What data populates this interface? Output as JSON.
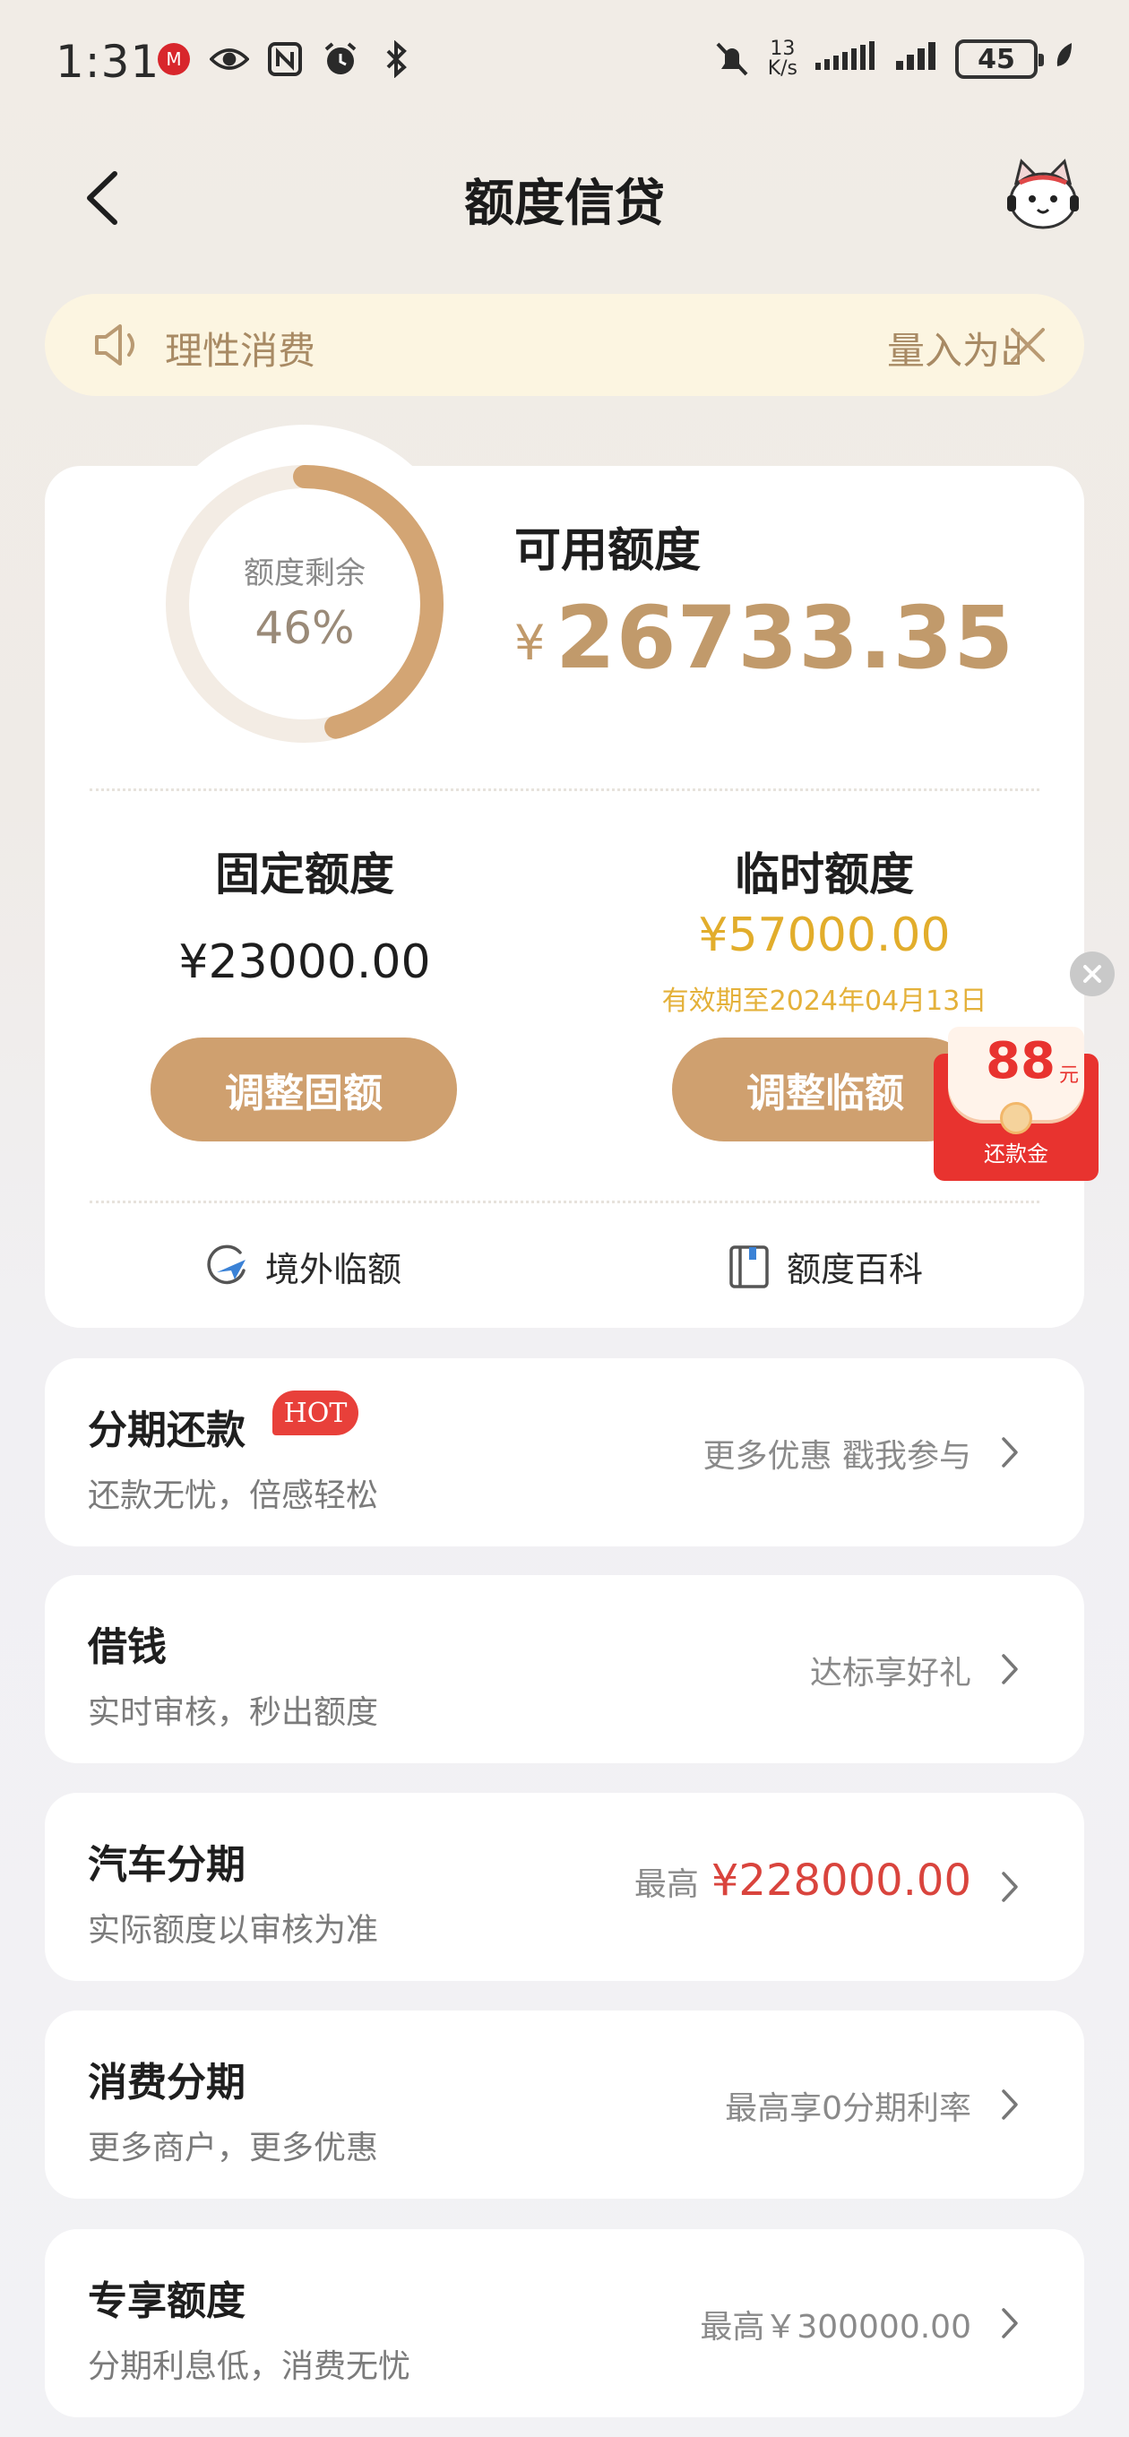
{
  "status_bar": {
    "time": "1:31",
    "net_speed_value": "13",
    "net_speed_unit": "K/s",
    "battery": "45"
  },
  "header": {
    "title": "额度信贷"
  },
  "notice": {
    "text": "理性消费",
    "scroll_text": "量入为出"
  },
  "quota": {
    "ring_label": "额度剩余",
    "ring_percent_text": "46%",
    "ring_percent": 0.46,
    "available_label": "可用额度",
    "available_currency": "¥",
    "available_amount": "26733.35",
    "fixed_title": "固定额度",
    "fixed_amount": "¥23000.00",
    "fixed_button": "调整固额",
    "temp_title": "临时额度",
    "temp_amount": "¥57000.00",
    "temp_expiry": "有效期至2024年04月13日",
    "temp_button": "调整临额",
    "overseas_link": "境外临额",
    "encyclopedia_link": "额度百科"
  },
  "red_packet": {
    "amount": "88",
    "unit": "元",
    "label": "还款金"
  },
  "services": [
    {
      "title": "分期还款",
      "badge": "HOT",
      "subtitle": "还款无忧，倍感轻松",
      "right_text": "更多优惠 戳我参与"
    },
    {
      "title": "借钱",
      "subtitle": "实时审核，秒出额度",
      "right_text": "达标享好礼"
    },
    {
      "title": "汽车分期",
      "subtitle": "实际额度以审核为准",
      "right_prefix": "最高",
      "right_amount": "¥228000.00"
    },
    {
      "title": "消费分期",
      "subtitle": "更多商户，更多优惠",
      "right_text": "最高享0分期利率"
    },
    {
      "title": "专享额度",
      "subtitle": "分期利息低，消费无忧",
      "right_text": "最高￥300000.00"
    }
  ],
  "colors": {
    "accent": "#cfa06f",
    "gold_text": "#c19a6b",
    "temp_yellow": "#e2ad2b",
    "red": "#d9443d"
  }
}
